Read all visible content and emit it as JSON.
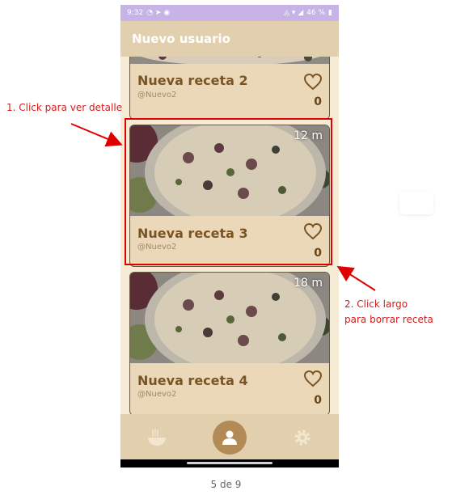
{
  "statusbar": {
    "time": "9:32",
    "battery": "46 %"
  },
  "appbar": {
    "title": "Nuevo usuario"
  },
  "recipes": [
    {
      "name": "Nueva receta 2",
      "author": "@Nuevo2",
      "likes": "0"
    },
    {
      "name": "Nueva receta 3",
      "author": "@Nuevo2",
      "likes": "0",
      "time": "12 m"
    },
    {
      "name": "Nueva receta 4",
      "author": "@Nuevo2",
      "likes": "0",
      "time": "18 m"
    }
  ],
  "fab": {
    "label": "+"
  },
  "annotations": {
    "note1": "1. Click para ver detalle",
    "note2_line1": "2. Click largo",
    "note2_line2": "para borrar receta"
  },
  "pagination": "5 de 9",
  "colors": {
    "accent": "#e00000",
    "fab": "#8bdc63",
    "appbar": "#e2cfae",
    "card": "#ead8b8",
    "status": "#c8b3e6"
  },
  "icons": {
    "nav_left": "ramen-bowl-icon",
    "nav_center": "person-icon",
    "nav_right": "gear-icon"
  }
}
